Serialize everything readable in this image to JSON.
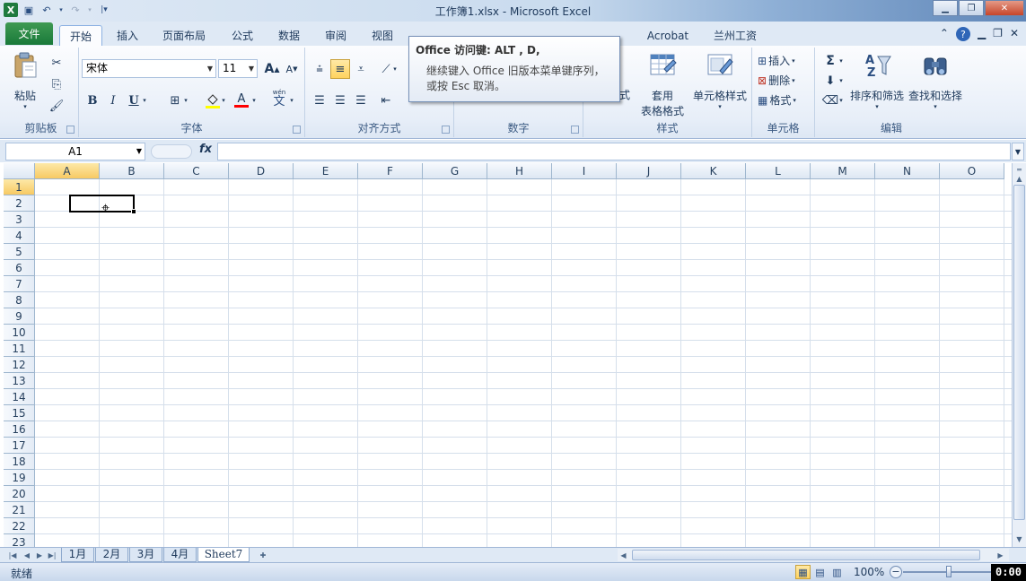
{
  "window": {
    "title": "工作簿1.xlsx - Microsoft Excel",
    "app_icon_letter": "X"
  },
  "quick_access": {
    "save_icon": "save-icon",
    "undo_icon": "undo-icon",
    "redo_icon": "redo-icon",
    "customize_icon": "customize-icon"
  },
  "tabs": {
    "file": "文件",
    "home": "开始",
    "insert": "插入",
    "page_layout": "页面布局",
    "formulas": "公式",
    "data": "数据",
    "review": "审阅",
    "view": "视图",
    "acrobat": "Acrobat",
    "lanzhou": "兰州工资"
  },
  "ribbon": {
    "clipboard": {
      "paste": "粘贴",
      "group_label": "剪贴板"
    },
    "font": {
      "name": "宋体",
      "size": "11",
      "bold": "B",
      "italic": "I",
      "underline": "U",
      "grow": "A",
      "shrink": "A",
      "color_letter": "A",
      "wen": "wén",
      "wen_char": "文",
      "group_label": "字体"
    },
    "alignment": {
      "group_label": "对齐方式"
    },
    "number": {
      "group_label": "数字"
    },
    "styles": {
      "cell_styles_partial": "式",
      "format_table": "套用",
      "format_table_line2": "表格格式",
      "cell_styles": "单元格样式",
      "group_label": "样式"
    },
    "cells": {
      "insert": "插入",
      "delete": "删除",
      "format": "格式",
      "group_label": "单元格"
    },
    "editing": {
      "sigma": "Σ",
      "sort_filter": "排序和筛选",
      "find_select": "查找和选择",
      "group_label": "编辑"
    }
  },
  "tooltip": {
    "title": "Office 访问键: ALT , D,",
    "line1": "继续键入 Office 旧版本菜单键序列，",
    "line2": "或按 Esc 取消。"
  },
  "formula_bar": {
    "name_box": "A1",
    "fx": "fx",
    "value": ""
  },
  "columns": [
    "A",
    "B",
    "C",
    "D",
    "E",
    "F",
    "G",
    "H",
    "I",
    "J",
    "K",
    "L",
    "M",
    "N",
    "O"
  ],
  "rows": [
    "1",
    "2",
    "3",
    "4",
    "5",
    "6",
    "7",
    "8",
    "9",
    "10",
    "11",
    "12",
    "13",
    "14",
    "15",
    "16",
    "17",
    "18",
    "19",
    "20",
    "21",
    "22",
    "23"
  ],
  "active_cell": "A1",
  "sheets": [
    "1月",
    "2月",
    "3月",
    "4月",
    "Sheet7"
  ],
  "active_sheet": "Sheet7",
  "status": {
    "text": "就绪",
    "zoom": "100%"
  },
  "overlay_timer": "0:00"
}
